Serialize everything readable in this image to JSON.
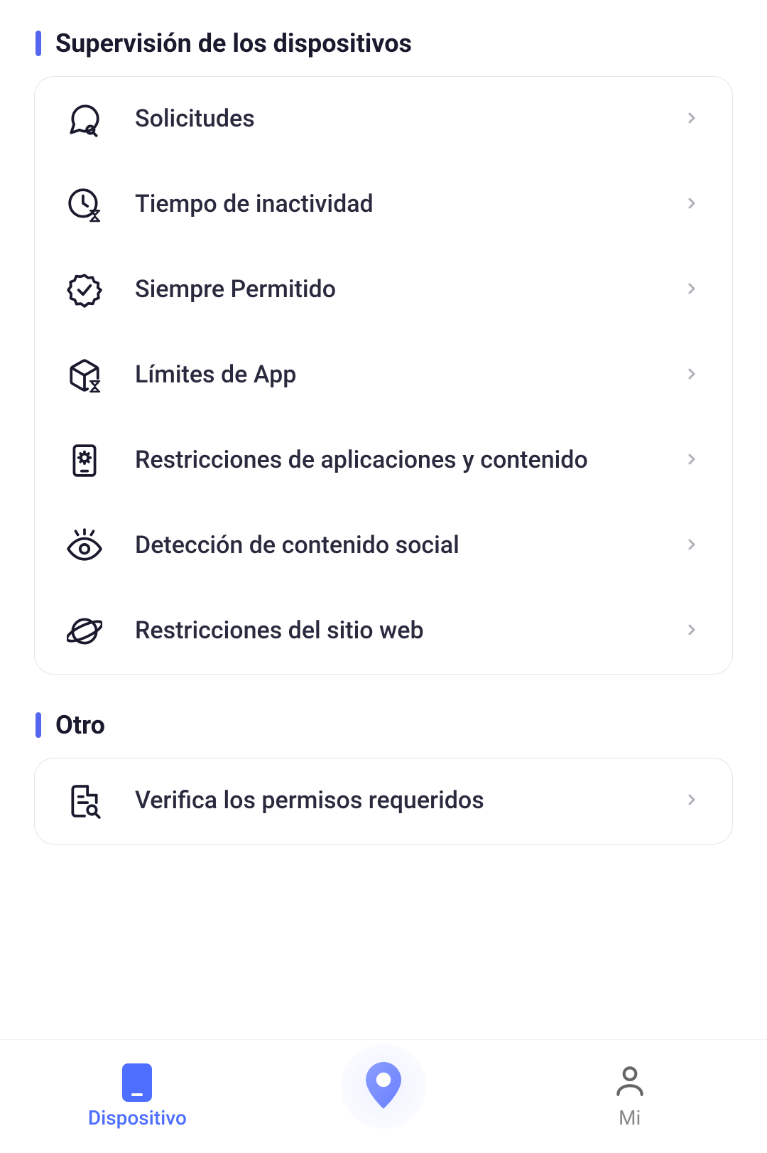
{
  "sections": [
    {
      "title": "Supervisión de los dispositivos",
      "items": [
        {
          "label": "Solicitudes",
          "icon": "chat-search"
        },
        {
          "label": "Tiempo de inactividad",
          "icon": "clock-hourglass"
        },
        {
          "label": "Siempre Permitido",
          "icon": "badge-check"
        },
        {
          "label": "Límites de App",
          "icon": "cube-hourglass"
        },
        {
          "label": "Restricciones de aplicaciones y contenido",
          "icon": "device-gear"
        },
        {
          "label": "Detección de contenido social",
          "icon": "eye-sparkle"
        },
        {
          "label": "Restricciones del sitio web",
          "icon": "planet"
        }
      ]
    },
    {
      "title": "Otro",
      "items": [
        {
          "label": "Verifica los permisos requeridos",
          "icon": "doc-search"
        }
      ]
    }
  ],
  "bottomNav": {
    "device": "Dispositivo",
    "mi": "Mi"
  }
}
